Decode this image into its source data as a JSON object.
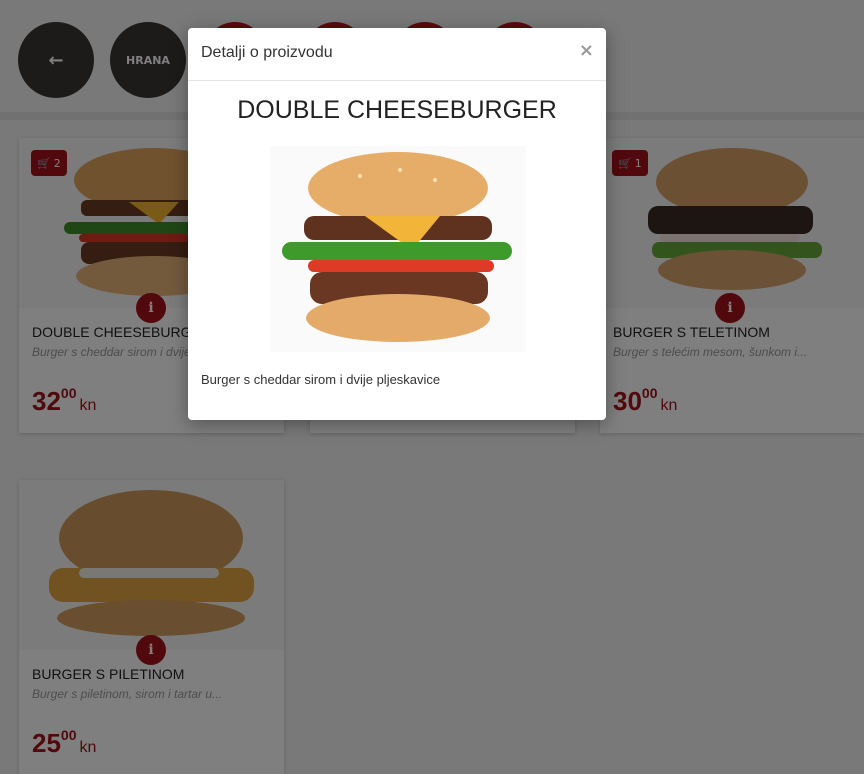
{
  "nav": {
    "back_icon": "arrow-left-icon",
    "back_glyph": "←",
    "category_label": "HRANA"
  },
  "products": [
    {
      "name": "DOUBLE CHEESEBURGER",
      "description": "Burger s cheddar sirom i dvije pljeskavice",
      "price_whole": "32",
      "price_cents": "00",
      "currency": "kn",
      "cart_count": "2",
      "info_glyph": "i"
    },
    {
      "name": "BURGER S TELETINOM",
      "description": "Burger s telećim mesom, šunkom i...",
      "price_whole": "30",
      "price_cents": "00",
      "currency": "kn",
      "cart_count": "1",
      "info_glyph": "i"
    },
    {
      "name": "BURGER S PILETINOM",
      "description": "Burger s piletinom, sirom i tartar u...",
      "price_whole": "25",
      "price_cents": "00",
      "currency": "kn",
      "info_glyph": "i"
    }
  ],
  "modal": {
    "title": "Detalji o proizvodu",
    "close_glyph": "×",
    "product_name": "DOUBLE CHEESEBURGER",
    "product_description": "Burger s cheddar sirom i dvije pljeskavice"
  },
  "colors": {
    "accent": "#a3121b",
    "nav_dark": "#3a3434",
    "nav_red": "#b8141a"
  }
}
